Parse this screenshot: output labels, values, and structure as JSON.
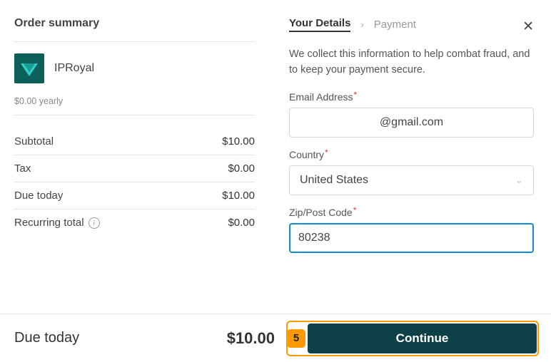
{
  "left": {
    "title": "Order summary",
    "product_name": "IPRoyal",
    "interval": "$0.00 yearly",
    "lines": {
      "subtotal_label": "Subtotal",
      "subtotal_value": "$10.00",
      "tax_label": "Tax",
      "tax_value": "$0.00",
      "due_label": "Due today",
      "due_value": "$10.00",
      "recur_label": "Recurring total",
      "recur_value": "$0.00"
    }
  },
  "right": {
    "crumb_active": "Your Details",
    "crumb_inactive": "Payment",
    "description": "We collect this information to help combat fraud, and to keep your payment secure.",
    "email_label": "Email Address",
    "email_value": "@gmail.com",
    "country_label": "Country",
    "country_value": "United States",
    "zip_label": "Zip/Post Code",
    "zip_value": "80238"
  },
  "footer": {
    "due_label": "Due today",
    "due_amount": "$10.00",
    "step": "5",
    "cta": "Continue"
  }
}
